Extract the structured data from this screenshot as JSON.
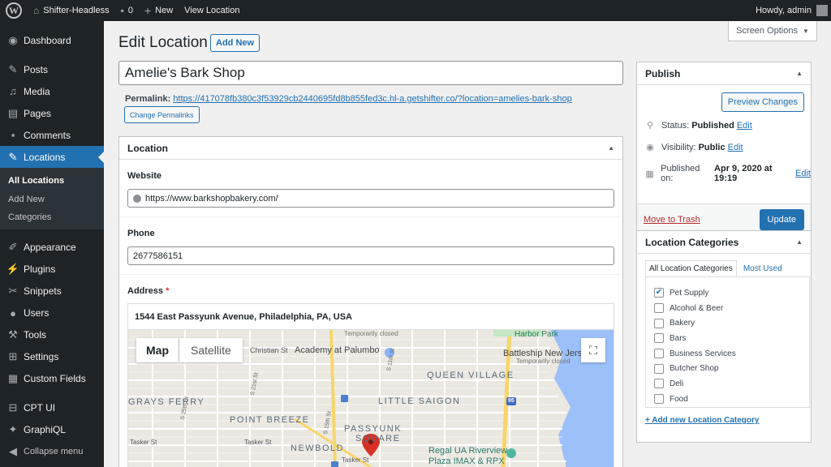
{
  "adminbar": {
    "site_name": "Shifter-Headless",
    "comments_count": "0",
    "new_label": "New",
    "view_label": "View Location",
    "howdy": "Howdy, admin"
  },
  "sidebar": {
    "items": [
      {
        "label": "Dashboard",
        "icon": "dashboard-icon"
      },
      {
        "label": "Posts",
        "icon": "pin-icon"
      },
      {
        "label": "Media",
        "icon": "media-icon"
      },
      {
        "label": "Pages",
        "icon": "pages-icon"
      },
      {
        "label": "Comments",
        "icon": "comment-icon"
      },
      {
        "label": "Locations",
        "icon": "pin-icon"
      },
      {
        "label": "Appearance",
        "icon": "brush-icon"
      },
      {
        "label": "Plugins",
        "icon": "plug-icon"
      },
      {
        "label": "Snippets",
        "icon": "scissors-icon"
      },
      {
        "label": "Users",
        "icon": "user-icon"
      },
      {
        "label": "Tools",
        "icon": "wrench-icon"
      },
      {
        "label": "Settings",
        "icon": "settings-icon"
      },
      {
        "label": "Custom Fields",
        "icon": "grid-icon"
      },
      {
        "label": "CPT UI",
        "icon": "cpt-icon"
      },
      {
        "label": "GraphiQL",
        "icon": "graphql-icon"
      },
      {
        "label": "Collapse menu",
        "icon": "collapse-icon"
      }
    ],
    "submenu": [
      "All Locations",
      "Add New",
      "Categories"
    ]
  },
  "header": {
    "screen_options": "Screen Options",
    "title": "Edit Location",
    "add_new": "Add New"
  },
  "post": {
    "title": "Amelie's Bark Shop",
    "permalink_label": "Permalink:",
    "permalink_url": "https://417078fb380c3f53929cb2440695fd8b855fed3c.hl-a.getshifter.co/?location=amelies-bark-shop",
    "change_permalinks": "Change Permalinks"
  },
  "location_box": {
    "title": "Location",
    "website_label": "Website",
    "website_value": "https://www.barkshopbakery.com/",
    "phone_label": "Phone",
    "phone_value": "2677586151",
    "address_label": "Address",
    "address_required": "*",
    "address_value": "1544 East Passyunk Avenue, Philadelphia, PA, USA",
    "map_tab": "Map",
    "satellite_tab": "Satellite",
    "map_labels": {
      "temp_closed_1": "Temporarily closed",
      "temp_closed_2": "Temporarily closed",
      "harbor_park": "Harbor Park",
      "christian_st": "Christian St",
      "academy": "Academy at Palumbo",
      "battleship": "Battleship New Jers",
      "queen_village": "QUEEN VILLAGE",
      "grays_ferry": "GRAYS FERRY",
      "little_saigon": "LITTLE SAIGON",
      "point_breeze": "POINT BREEZE",
      "passyunk": "PASSYUNK",
      "square": "SQUARE",
      "newbold": "NEWBOLD",
      "tasker_1": "Tasker St",
      "tasker_2": "Tasker St",
      "tasker_3": "Tasker St",
      "regal_1": "Regal UA Riverview",
      "regal_2": "Plaza IMAX & RPX",
      "st_25": "S 25th St",
      "st_21": "S 21st St",
      "st_15": "S 15th St",
      "st_11": "S 11th St",
      "hwy_95": "95"
    }
  },
  "publish": {
    "title": "Publish",
    "preview": "Preview Changes",
    "status_label": "Status:",
    "status_value": "Published",
    "visibility_label": "Visibility:",
    "visibility_value": "Public",
    "published_label": "Published on:",
    "published_value": "Apr 9, 2020 at 19:19",
    "edit": "Edit",
    "trash": "Move to Trash",
    "update": "Update"
  },
  "categories": {
    "title": "Location Categories",
    "tab_all": "All Location Categories",
    "tab_most_used": "Most Used",
    "items": [
      {
        "label": "Pet Supply",
        "checked": true
      },
      {
        "label": "Alcohol & Beer",
        "checked": false
      },
      {
        "label": "Bakery",
        "checked": false
      },
      {
        "label": "Bars",
        "checked": false
      },
      {
        "label": "Business Services",
        "checked": false
      },
      {
        "label": "Butcher Shop",
        "checked": false
      },
      {
        "label": "Deli",
        "checked": false
      },
      {
        "label": "Food",
        "checked": false
      }
    ],
    "add_new": "+ Add new Location Category"
  },
  "colors": {
    "admin_bar": "#1d2327",
    "accent": "#2271b1",
    "trash": "#b32d2e",
    "map_pin": "#d93025"
  }
}
